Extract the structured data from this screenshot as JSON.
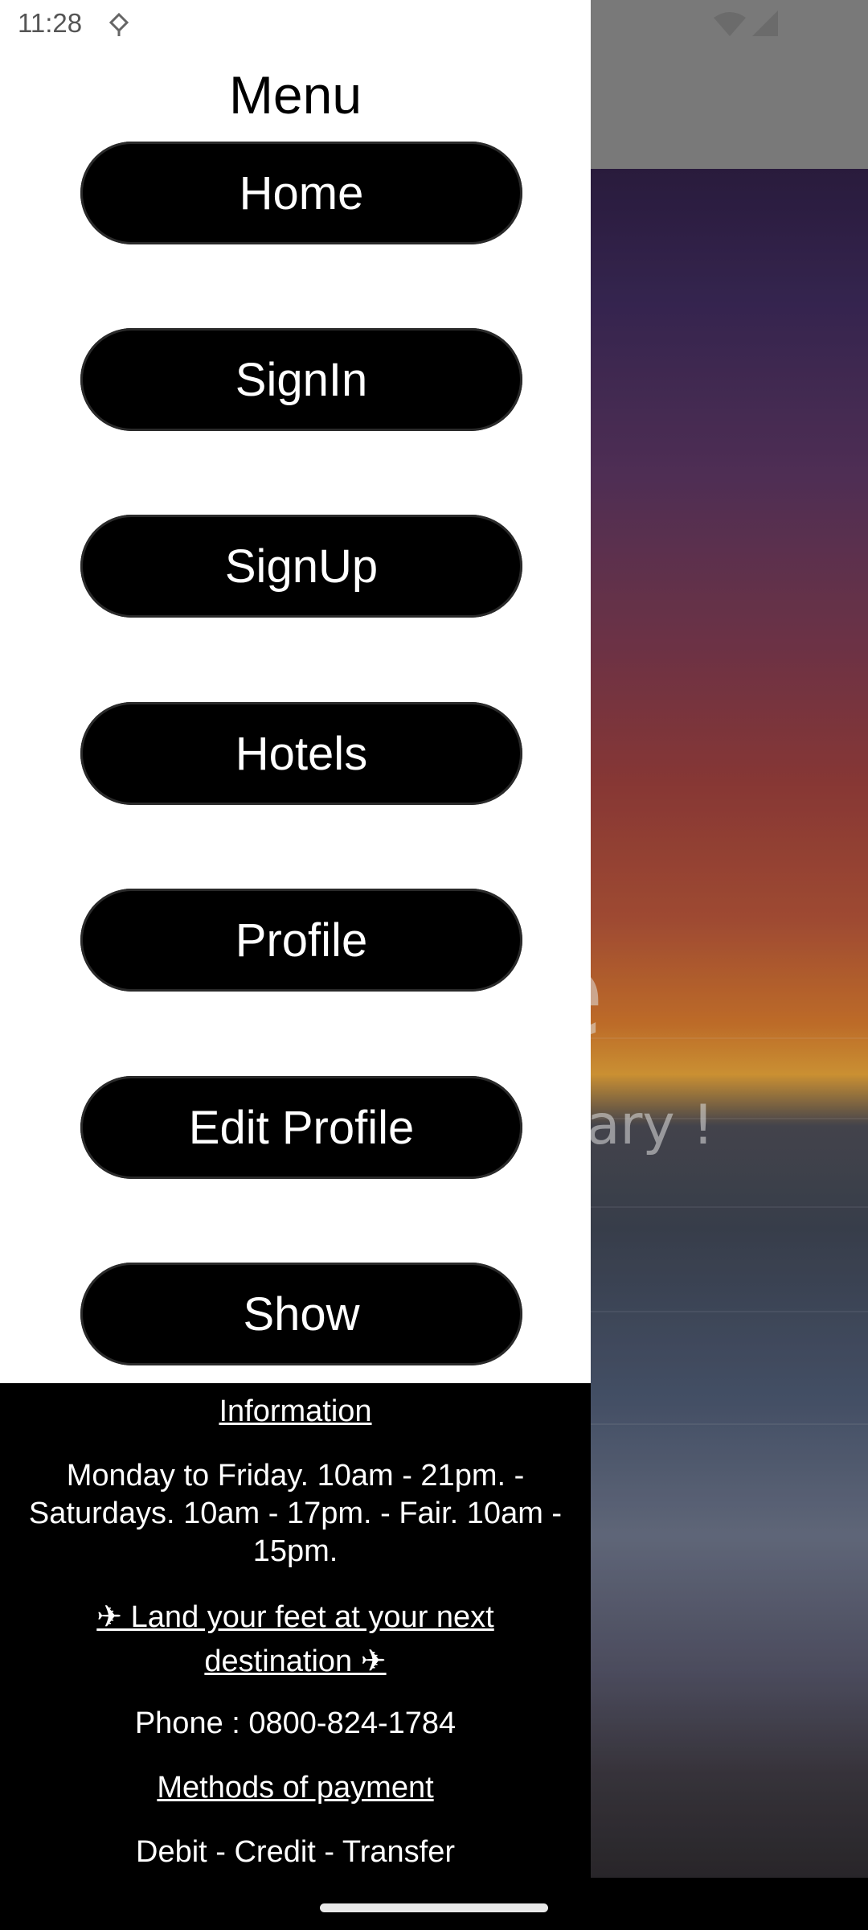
{
  "status_bar": {
    "time": "11:28",
    "icons": [
      "notification-icon",
      "wifi-icon",
      "signal-icon"
    ]
  },
  "drawer": {
    "title": "Menu",
    "items": [
      {
        "label": "Home"
      },
      {
        "label": "SignIn"
      },
      {
        "label": "SignUp"
      },
      {
        "label": "Hotels"
      },
      {
        "label": "Profile"
      },
      {
        "label": "Edit Profile"
      },
      {
        "label": "Show"
      }
    ]
  },
  "footer": {
    "info_title": "Information",
    "hours": "Monday to Friday. 10am - 21pm. - Saturdays. 10am - 17pm. - Fair. 10am - 15pm.",
    "tagline": "✈ Land your feet at your next destination ✈",
    "phone": "Phone : 0800-824-1784",
    "payment_title": "Methods of payment",
    "payment_methods": "Debit - Credit - Transfer"
  },
  "background_app": {
    "title_fragment": "e",
    "subtitle_fragment": "erary !"
  },
  "colors": {
    "drawer_bg": "#ffffff",
    "button_bg": "#000000",
    "button_text": "#ffffff",
    "footer_bg": "#000000",
    "appbar_bg": "#8a8a8a"
  }
}
